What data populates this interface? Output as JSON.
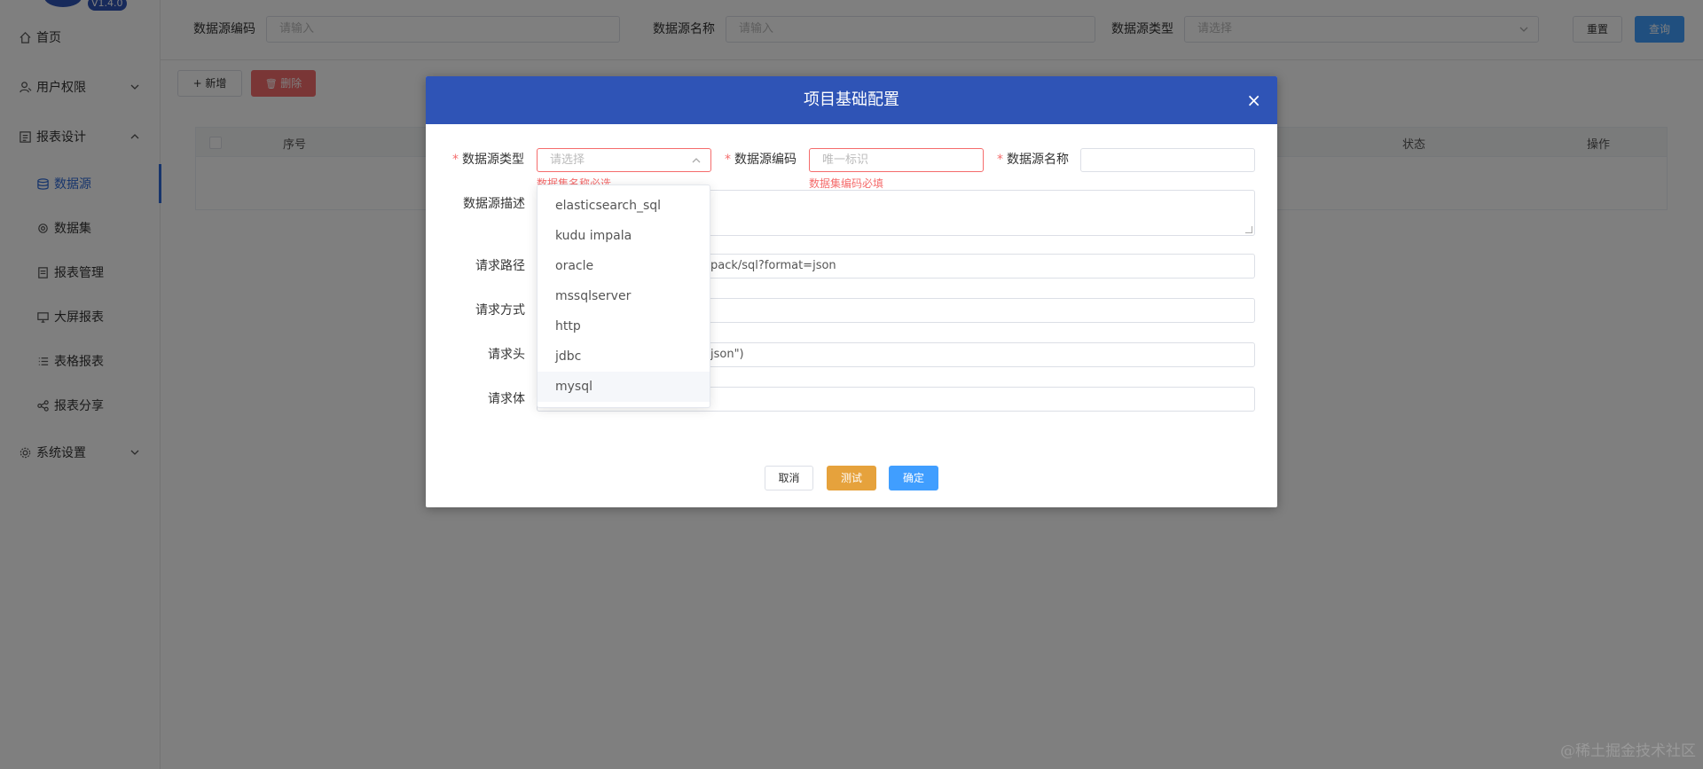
{
  "sidebar": {
    "version": "V1.4.0",
    "items": [
      {
        "label": "首页"
      },
      {
        "label": "用户权限"
      },
      {
        "label": "报表设计"
      },
      {
        "label": "数据源"
      },
      {
        "label": "数据集"
      },
      {
        "label": "报表管理"
      },
      {
        "label": "大屏报表"
      },
      {
        "label": "表格报表"
      },
      {
        "label": "报表分享"
      },
      {
        "label": "系统设置"
      }
    ]
  },
  "search": {
    "code_label": "数据源编码",
    "code_placeholder": "请输入",
    "name_label": "数据源名称",
    "name_placeholder": "请输入",
    "type_label": "数据源类型",
    "type_placeholder": "请选择",
    "reset_label": "重置",
    "query_label": "查询"
  },
  "toolbar": {
    "add_label": "+ 新增",
    "delete_label": "删除"
  },
  "table": {
    "columns": [
      "序号",
      "状态",
      "操作"
    ]
  },
  "dialog": {
    "title": "项目基础配置",
    "close": "×",
    "fields": {
      "type_label": "数据源类型",
      "type_placeholder": "请选择",
      "type_error": "数据集名称必选",
      "code_label": "数据源编码",
      "code_placeholder": "唯一标识",
      "code_error": "数据集编码必填",
      "name_label": "数据源名称",
      "desc_label": "数据源描述",
      "path_label": "请求路径",
      "path_value": "pack/sql?format=json",
      "method_label": "请求方式",
      "header_label": "请求头",
      "header_value": "json\")",
      "body_label": "请求体"
    },
    "cancel_label": "取消",
    "test_label": "测试",
    "confirm_label": "确定"
  },
  "dropdown": {
    "options": [
      "elasticsearch_sql",
      "kudu impala",
      "oracle",
      "mssqlserver",
      "http",
      "jdbc",
      "mysql"
    ],
    "hovered": "mysql"
  },
  "watermark": "@稀土掘金技术社区",
  "colors": {
    "primary": "#2f54b6",
    "accent": "#409eff",
    "danger": "#f56c6c",
    "warning": "#e6a23c"
  }
}
